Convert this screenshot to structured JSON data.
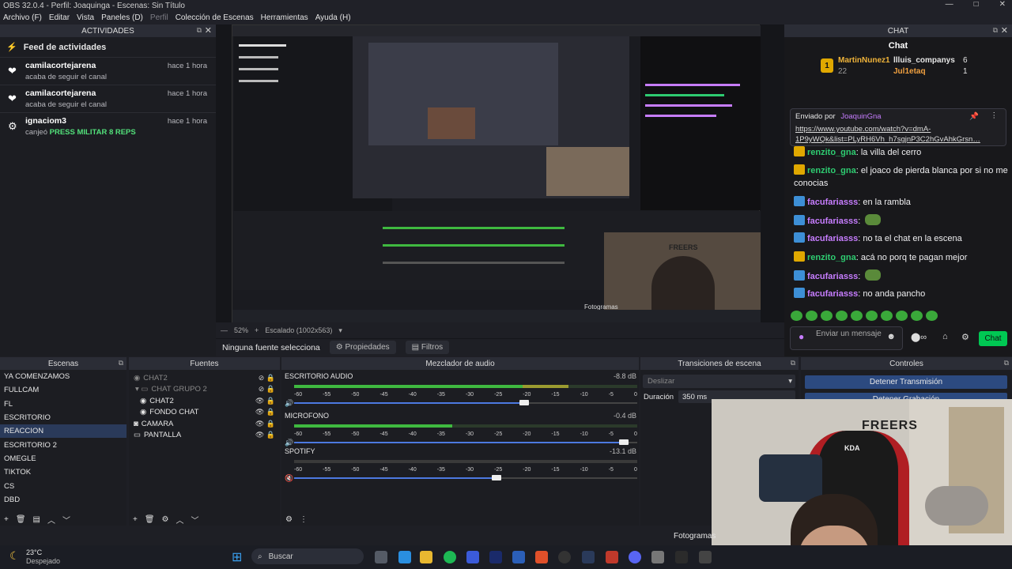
{
  "window": {
    "title": "OBS 32.0.4 - Perfil: Joaquinga - Escenas: Sin Título",
    "controls": [
      "—",
      "□",
      "✕"
    ]
  },
  "menu": {
    "items": [
      {
        "label": "Archivo (F)",
        "enabled": true
      },
      {
        "label": "Editar",
        "enabled": true
      },
      {
        "label": "Vista",
        "enabled": true
      },
      {
        "label": "Paneles (D)",
        "enabled": true
      },
      {
        "label": "Perfil",
        "enabled": false
      },
      {
        "label": "Colección de Escenas",
        "enabled": true
      },
      {
        "label": "Herramientas",
        "enabled": true
      },
      {
        "label": "Ayuda (H)",
        "enabled": true
      }
    ]
  },
  "activity": {
    "dock_title": "ACTIVIDADES",
    "feed_title": "Feed de actividades",
    "items": [
      {
        "user": "camilacortejarena",
        "text": "acaba de seguir el canal",
        "highlight": "",
        "time": "hace 1 hora",
        "icon": "heart-icon"
      },
      {
        "user": "camilacortejarena",
        "text": "acaba de seguir el canal",
        "highlight": "",
        "time": "hace 1 hora",
        "icon": "heart-icon"
      },
      {
        "user": "ignaciom3",
        "text": "canjeó",
        "highlight": "PRESS MILITAR 8 REPS",
        "time": "hace 1 hora",
        "icon": "points-icon"
      }
    ]
  },
  "preview": {
    "zoom": "52%",
    "scale_label": "Escalado (1002x563)",
    "no_source": "Ninguna fuente selecciona",
    "properties": "Propiedades",
    "filters": "Filtros",
    "inner_label": "Fotogramas",
    "inner_stream_text": "FREERS"
  },
  "chat": {
    "dock_title": "CHAT",
    "header": "Chat",
    "leaderboard": [
      {
        "rank": "1",
        "name": "MartinNunez1",
        "count": "22"
      },
      {
        "name": "llluis_companys",
        "count": "6"
      },
      {
        "name": "Jul1etaq",
        "count": "1"
      }
    ],
    "pinned": {
      "label": "Enviado por",
      "user": "JoaquinGna",
      "url": "https://www.youtube.com/watch?v=dmA-1P9yWQk&list=PLyRH6Vh_h7sgjnP3C2hGvAhkGrsn…"
    },
    "messages": [
      {
        "user": "renzito_gna",
        "text": "la villa del cerro",
        "color": "#2ecc71",
        "badge": "crown"
      },
      {
        "user": "renzito_gna",
        "text": "el joaco de pierda blanca por si no me conocias",
        "color": "#2ecc71",
        "badge": "crown"
      },
      {
        "user": "facufariasss",
        "text": "en la rambla",
        "color": "#c77dff",
        "badge": "arrow"
      },
      {
        "user": "facufariasss",
        "text": "",
        "color": "#c77dff",
        "badge": "arrow"
      },
      {
        "user": "facufariasss",
        "text": "no ta el chat en la escena",
        "color": "#c77dff",
        "badge": "arrow"
      },
      {
        "user": "renzito_gna",
        "text": "acá no porq te pagan mejor",
        "color": "#2ecc71",
        "badge": "crown"
      },
      {
        "user": "facufariasss",
        "text": "",
        "color": "#c77dff",
        "badge": "arrow"
      },
      {
        "user": "facufariasss",
        "text": "no anda pancho",
        "color": "#c77dff",
        "badge": "arrow"
      }
    ],
    "input_placeholder": "Enviar un mensaje",
    "send_label": "Chat"
  },
  "scenes": {
    "title": "Escenas",
    "items": [
      "YA COMENZAMOS",
      "FULLCAM",
      "FL",
      "ESCRITORIO",
      "REACCION",
      "ESCRITORIO 2",
      "OMEGLE",
      "TIKTOK",
      "CS",
      "DBD"
    ],
    "selected": "REACCION"
  },
  "sources": {
    "title": "Fuentes",
    "items": [
      {
        "label": "CHAT2",
        "dim": true,
        "indent": 0
      },
      {
        "label": "CHAT GRUPO 2",
        "dim": true,
        "indent": 1
      },
      {
        "label": "CHAT2",
        "dim": false,
        "indent": 2
      },
      {
        "label": "FONDO CHAT",
        "dim": false,
        "indent": 2
      },
      {
        "label": "CAMARA",
        "dim": false,
        "indent": 0
      },
      {
        "label": "PANTALLA",
        "dim": false,
        "indent": 0
      }
    ]
  },
  "mixer": {
    "title": "Mezclador de audio",
    "scale": [
      "-60",
      "-55",
      "-50",
      "-45",
      "-40",
      "-35",
      "-30",
      "-25",
      "-20",
      "-15",
      "-10",
      "-5",
      "0"
    ],
    "channels": [
      {
        "name": "ESCRITORIO AUDIO",
        "db": "-8.8 dB",
        "level": 0.8,
        "fader": 0.67,
        "muted": false
      },
      {
        "name": "MICROFONO",
        "db": "-0.4 dB",
        "level": 0.46,
        "fader": 0.96,
        "muted": false
      },
      {
        "name": "SPOTIFY",
        "db": "-13.1 dB",
        "level": 0.0,
        "fader": 0.59,
        "muted": true
      }
    ]
  },
  "transitions": {
    "title": "Transiciones de escena",
    "selected": "Deslizar",
    "duration_label": "Duración",
    "duration_value": "350 ms"
  },
  "controls": {
    "title": "Controles",
    "stop_stream": "Detener Transmisión",
    "stop_record": "Detener Grabación",
    "frames_label": "Fotogramas"
  },
  "webcam": {
    "mirror_text": "FREERS",
    "chair_logo": "KDA"
  },
  "taskbar": {
    "weather_temp": "23°C",
    "weather_desc": "Despejado",
    "search_placeholder": "Buscar"
  }
}
